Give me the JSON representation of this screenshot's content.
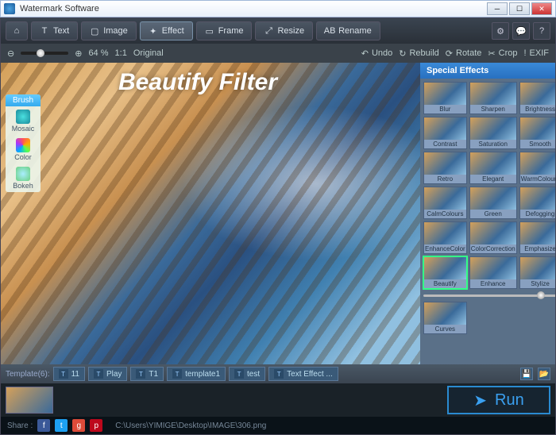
{
  "window": {
    "title": "Watermark Software"
  },
  "toolbar": {
    "home": "⌂",
    "text": "Text",
    "image": "Image",
    "effect": "Effect",
    "frame": "Frame",
    "resize": "Resize",
    "rename": "Rename"
  },
  "ctrl": {
    "zoom_pct": "64 %",
    "ratio": "1:1",
    "original": "Original",
    "undo": "Undo",
    "rebuild": "Rebuild",
    "rotate": "Rotate",
    "crop": "Crop",
    "exif": "EXIF"
  },
  "canvas": {
    "overlay_title": "Beautify Filter"
  },
  "brush": {
    "header": "Brush",
    "items": [
      {
        "label": "Mosaic",
        "color": "radial-gradient(#4ae0e0,#1a8a9a)"
      },
      {
        "label": "Color",
        "color": "conic-gradient(#f55,#fa0,#5f5,#0af,#a3f,#f55)"
      },
      {
        "label": "Bokeh",
        "color": "radial-gradient(#aef,#6ad080)"
      }
    ]
  },
  "side": {
    "header": "Special Effects",
    "effects": [
      "Blur",
      "Sharpen",
      "Brightness",
      "Contrast",
      "Saturation",
      "Smooth",
      "Retro",
      "Elegant",
      "WarmColours",
      "CalmColours",
      "Green",
      "Defogging",
      "EnhanceColor",
      "ColorCorrection",
      "Emphasize",
      "Beautify",
      "Enhance",
      "Stylize",
      "Curves"
    ],
    "selected": "Beautify"
  },
  "templates": {
    "label": "Template(6):",
    "items": [
      "11",
      "Play",
      "T1",
      "template1",
      "test",
      "Text Effect ..."
    ]
  },
  "run": {
    "label": "Run"
  },
  "share": {
    "label": "Share :",
    "path": "C:\\Users\\YIMIGE\\Desktop\\IMAGE\\306.png"
  }
}
